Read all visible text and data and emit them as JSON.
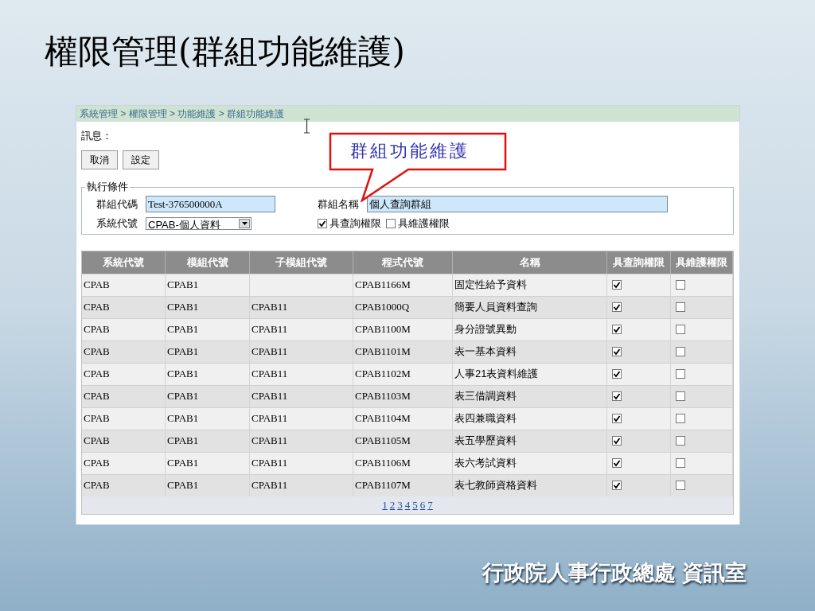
{
  "title": "權限管理(群組功能維護)",
  "breadcrumb": "系統管理 > 權限管理 > 功能維護 > 群組功能維護",
  "message_label": "訊息：",
  "buttons": [
    "取消",
    "設定"
  ],
  "callout": "群組功能維護",
  "fieldset": {
    "legend": "執行條件",
    "group_code": {
      "label": "群組代碼",
      "value": "Test-376500000A"
    },
    "group_name": {
      "label": "群組名稱",
      "value": "個人查詢群組"
    },
    "system_code": {
      "label": "系統代號",
      "value": "CPAB-個人資料"
    },
    "checkboxes": [
      {
        "label": "具查詢權限",
        "checked": true
      },
      {
        "label": "具維護權限",
        "checked": false
      }
    ]
  },
  "table": {
    "columns": [
      "系統代號",
      "模組代號",
      "子模組代號",
      "程式代號",
      "名稱",
      "具查詢權限",
      "具維護權限"
    ],
    "rows": [
      {
        "cells": [
          "CPAB",
          "CPAB1",
          "",
          "CPAB1166M",
          "固定性給予資料"
        ],
        "query": true,
        "maintain": false
      },
      {
        "cells": [
          "CPAB",
          "CPAB1",
          "CPAB11",
          "CPAB1000Q",
          "簡要人員資料查詢"
        ],
        "query": true,
        "maintain": false
      },
      {
        "cells": [
          "CPAB",
          "CPAB1",
          "CPAB11",
          "CPAB1100M",
          "身分證號異動"
        ],
        "query": true,
        "maintain": false
      },
      {
        "cells": [
          "CPAB",
          "CPAB1",
          "CPAB11",
          "CPAB1101M",
          "表一基本資料"
        ],
        "query": true,
        "maintain": false
      },
      {
        "cells": [
          "CPAB",
          "CPAB1",
          "CPAB11",
          "CPAB1102M",
          "人事21表資料維護"
        ],
        "query": true,
        "maintain": false
      },
      {
        "cells": [
          "CPAB",
          "CPAB1",
          "CPAB11",
          "CPAB1103M",
          "表三借調資料"
        ],
        "query": true,
        "maintain": false
      },
      {
        "cells": [
          "CPAB",
          "CPAB1",
          "CPAB11",
          "CPAB1104M",
          "表四兼職資料"
        ],
        "query": true,
        "maintain": false
      },
      {
        "cells": [
          "CPAB",
          "CPAB1",
          "CPAB11",
          "CPAB1105M",
          "表五學歷資料"
        ],
        "query": true,
        "maintain": false
      },
      {
        "cells": [
          "CPAB",
          "CPAB1",
          "CPAB11",
          "CPAB1106M",
          "表六考試資料"
        ],
        "query": true,
        "maintain": false
      },
      {
        "cells": [
          "CPAB",
          "CPAB1",
          "CPAB11",
          "CPAB1107M",
          "表七教師資格資料"
        ],
        "query": true,
        "maintain": false
      }
    ],
    "pagination": [
      "1",
      "2",
      "3",
      "4",
      "5",
      "6",
      "7"
    ]
  },
  "footer": "行政院人事行政總處 資訊室"
}
